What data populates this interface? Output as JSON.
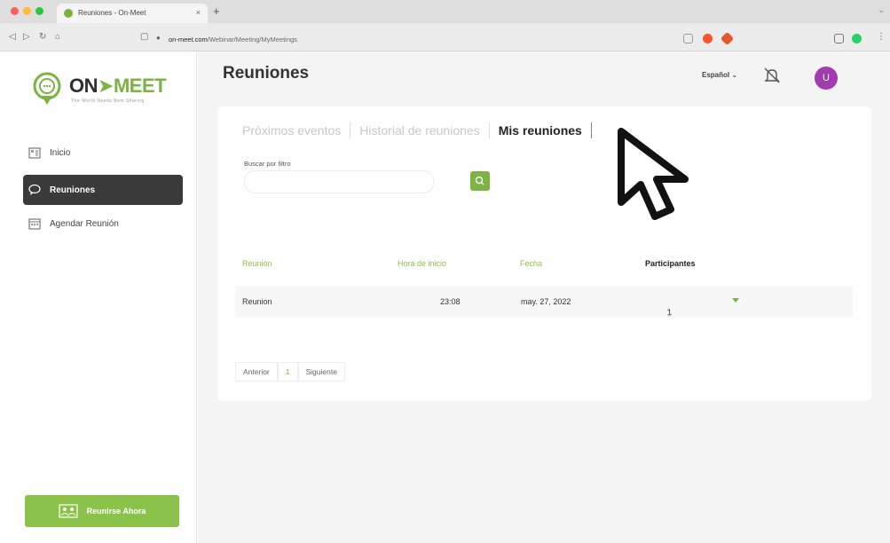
{
  "browser": {
    "tab_title": "Reuniones - On-Meet",
    "tab_close": "×",
    "new_tab": "+",
    "url_host": "on-meet.com",
    "url_path": "/Webinar/Meeting/MyMeetings"
  },
  "sidebar": {
    "logo_on": "ON",
    "logo_meet": "MEET",
    "logo_tagline": "The World Needs Bem Sharing",
    "items": [
      {
        "label": "Inicio",
        "icon": "home-icon"
      },
      {
        "label": "Reuniones",
        "icon": "meetings-icon",
        "active": true
      },
      {
        "label": "Agendar Reunión",
        "icon": "calendar-icon"
      }
    ],
    "start_button": "Reunirse Ahora"
  },
  "header": {
    "title": "Reuniones",
    "language": "Español",
    "avatar_initial": "U"
  },
  "tabs": [
    "Próximos eventos",
    "Historial de reuniones",
    "Mis reuniones"
  ],
  "filter": {
    "label": "Buscar por filtro",
    "placeholder": ""
  },
  "table": {
    "headers": [
      "Reunión",
      "Hora de inicio",
      "Fecha",
      "Participantes"
    ],
    "rows": [
      {
        "name": "Reunion",
        "start": "23:08",
        "date": "may. 27, 2022",
        "participants": "1",
        "participants_suffix": "/∞"
      }
    ]
  },
  "pager": {
    "prev": "Anterior",
    "page": "1",
    "next": "Siguiente"
  },
  "colors": {
    "accent": "#7cb342",
    "dark_nav": "#3a3a3a",
    "avatar": "#a23bb0"
  }
}
